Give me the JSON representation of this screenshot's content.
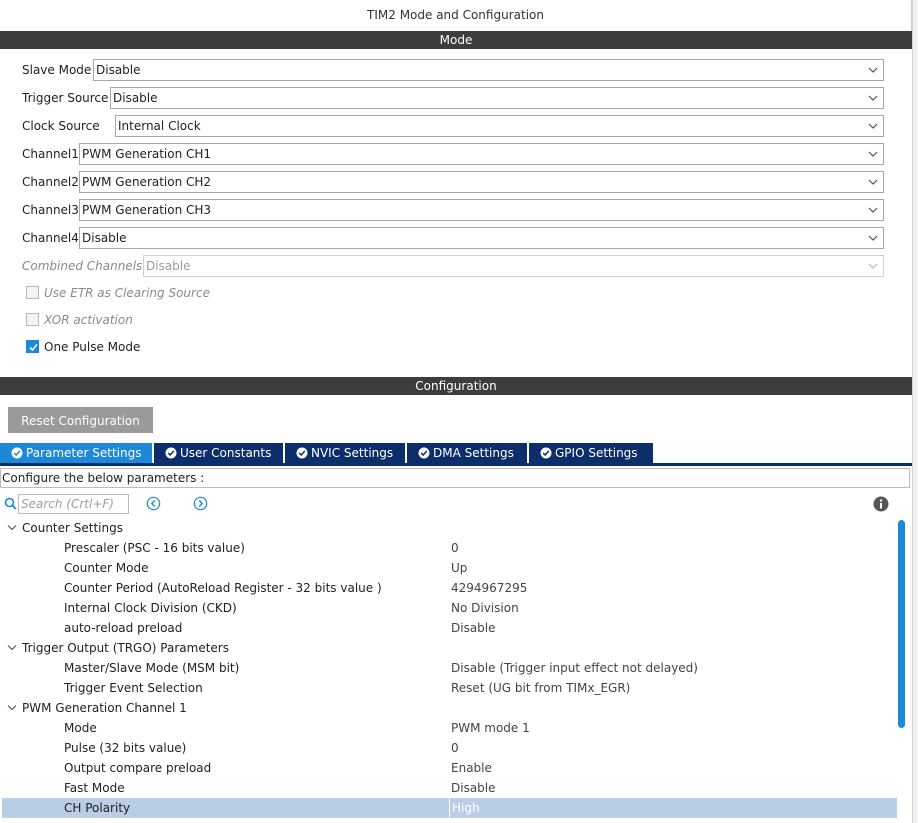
{
  "window": {
    "title": "TIM2 Mode and Configuration"
  },
  "mode": {
    "header": "Mode",
    "fields": [
      {
        "label": "Slave Mode",
        "value": "Disable",
        "disabled": false
      },
      {
        "label": "Trigger Source",
        "value": "Disable",
        "disabled": false
      },
      {
        "label": "Clock Source",
        "value": "Internal Clock",
        "disabled": false
      },
      {
        "label": "Channel1",
        "value": "PWM Generation CH1",
        "disabled": false
      },
      {
        "label": "Channel2",
        "value": "PWM Generation CH2",
        "disabled": false
      },
      {
        "label": "Channel3",
        "value": "PWM Generation CH3",
        "disabled": false
      },
      {
        "label": "Channel4",
        "value": "Disable",
        "disabled": false
      },
      {
        "label": "Combined Channels",
        "value": "Disable",
        "disabled": true
      }
    ],
    "checkboxes": [
      {
        "label": "Use ETR as Clearing Source",
        "checked": false,
        "disabled": true
      },
      {
        "label": "XOR activation",
        "checked": false,
        "disabled": true
      },
      {
        "label": "One Pulse Mode",
        "checked": true,
        "disabled": false
      }
    ]
  },
  "configuration": {
    "header": "Configuration",
    "reset_label": "Reset Configuration",
    "tabs": [
      {
        "label": "Parameter Settings",
        "active": true
      },
      {
        "label": "User Constants",
        "active": false
      },
      {
        "label": "NVIC Settings",
        "active": false
      },
      {
        "label": "DMA Settings",
        "active": false
      },
      {
        "label": "GPIO Settings",
        "active": false
      }
    ],
    "instruction": "Configure the below parameters :",
    "search_placeholder": "Search (Crtl+F)",
    "groups": [
      {
        "name": "Counter Settings",
        "params": [
          {
            "name": "Prescaler (PSC - 16 bits value)",
            "value": "0"
          },
          {
            "name": "Counter Mode",
            "value": "Up"
          },
          {
            "name": "Counter Period (AutoReload Register - 32 bits value )",
            "value": "4294967295"
          },
          {
            "name": "Internal Clock Division (CKD)",
            "value": "No Division"
          },
          {
            "name": "auto-reload preload",
            "value": "Disable"
          }
        ]
      },
      {
        "name": "Trigger Output (TRGO) Parameters",
        "params": [
          {
            "name": "Master/Slave Mode (MSM bit)",
            "value": "Disable (Trigger input effect not delayed)"
          },
          {
            "name": "Trigger Event Selection",
            "value": "Reset (UG bit from TIMx_EGR)"
          }
        ]
      },
      {
        "name": "PWM Generation Channel 1",
        "params": [
          {
            "name": "Mode",
            "value": "PWM mode 1"
          },
          {
            "name": "Pulse (32 bits value)",
            "value": "0"
          },
          {
            "name": "Output compare preload",
            "value": "Enable"
          },
          {
            "name": "Fast Mode",
            "value": "Disable"
          },
          {
            "name": "CH Polarity",
            "value": "High",
            "selected": true
          }
        ]
      }
    ]
  },
  "colors": {
    "accent": "#1e88d8",
    "tab_dark": "#0c2f6b",
    "header_bar": "#3d3d3d",
    "selected_row": "#b9cde4"
  }
}
